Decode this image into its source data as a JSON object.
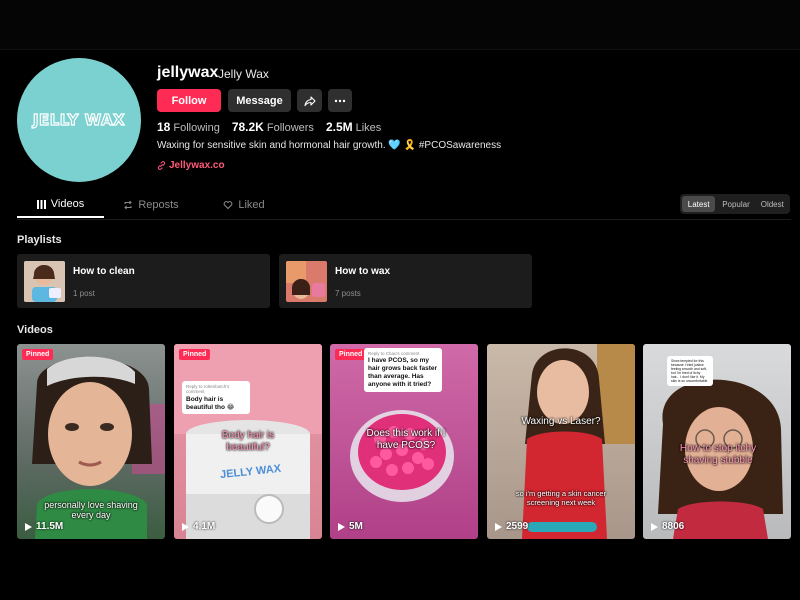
{
  "profile": {
    "username": "jellywax",
    "display_name": "Jelly Wax",
    "avatar_text": "JELLY WAX",
    "follow_label": "Follow",
    "message_label": "Message",
    "stats": {
      "following_count": "18",
      "following_label": "Following",
      "followers_count": "78.2K",
      "followers_label": "Followers",
      "likes_count": "2.5M",
      "likes_label": "Likes"
    },
    "bio": "Waxing for sensitive skin and hormonal hair growth. 🩵 🎗️ #PCOSawareness",
    "link": "Jellywax.co"
  },
  "tabs": [
    "Videos",
    "Reposts",
    "Liked"
  ],
  "sort": [
    "Latest",
    "Popular",
    "Oldest"
  ],
  "playlists_title": "Playlists",
  "playlists": [
    {
      "name": "How to clean",
      "count": "1 post"
    },
    {
      "name": "How to wax",
      "count": "7 posts"
    }
  ],
  "videos_title": "Videos",
  "videos": [
    {
      "pinned": "Pinned",
      "views": "11.5M",
      "caption": "personally love shaving every day"
    },
    {
      "pinned": "Pinned",
      "views": "4.1M",
      "caption": "Body hair is beautiful?",
      "bubble_reply": "Reply to rottenbutch's comment",
      "bubble_text": "Body hair is beautiful tho 😂",
      "product_text": "JELLY WAX"
    },
    {
      "pinned": "Pinned",
      "views": "5M",
      "caption": "Does this work if I have PCOS?",
      "bubble_reply": "Reply to Chau's comment",
      "bubble_text": "I have PCOS, so my hair grows back faster than average. Has anyone with it tried?"
    },
    {
      "views": "2599",
      "caption": "Waxing vs Laser?",
      "sub_caption": "so i'm getting a skin cancer screening next week"
    },
    {
      "views": "8806",
      "caption": "How to stop itchy shaving stubble",
      "bubble_text": "Since tempted for this because I tried justice feeling smooth and soft, but I'm tired of itchy hair... I don't like it. My skin is so uncomfortable"
    }
  ],
  "colors": {
    "accent": "#fe2c55",
    "avatar_bg": "#7bd0d0",
    "link": "#ff5a7a"
  }
}
